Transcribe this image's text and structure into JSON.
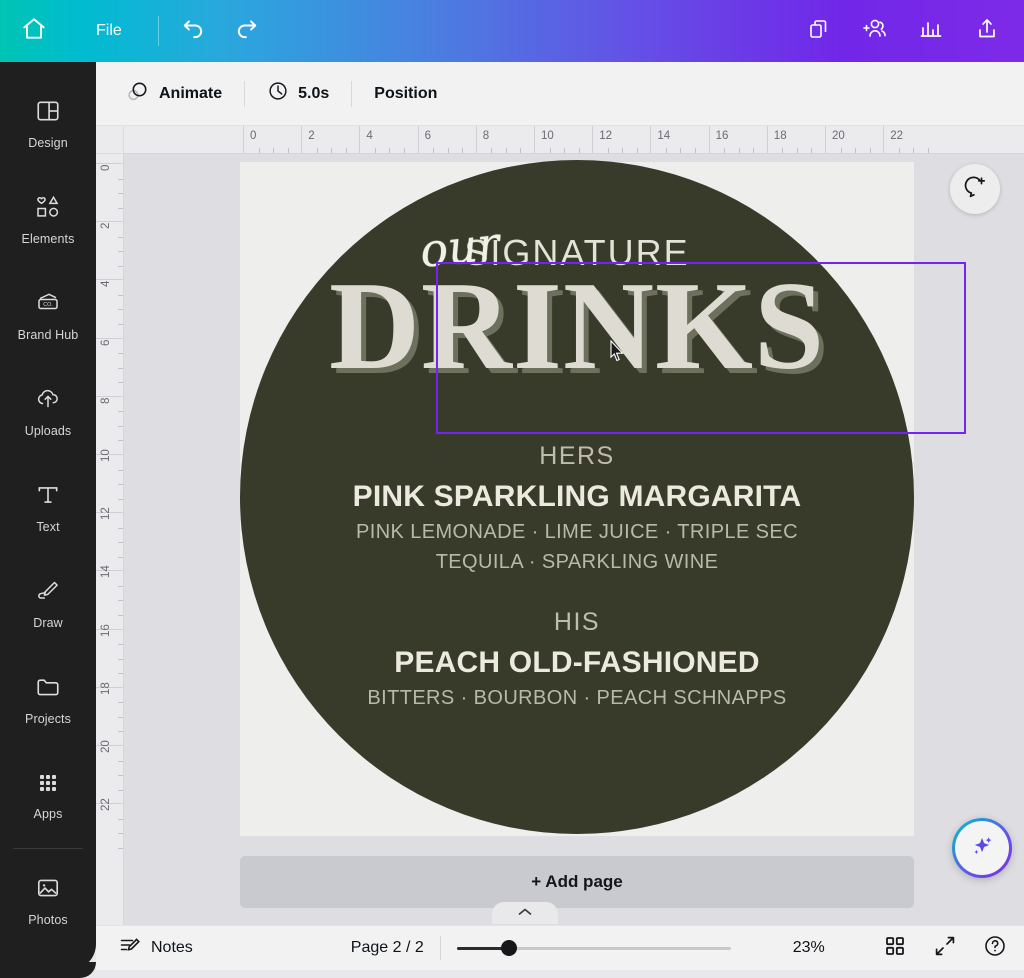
{
  "topbar": {
    "home_icon": "home-icon",
    "file_label": "File",
    "undo_icon": "undo-icon",
    "redo_icon": "redo-icon",
    "right_icons": [
      {
        "name": "duplicate-pages-icon",
        "label": "Duplicate pages"
      },
      {
        "name": "add-collaborator-icon",
        "label": "Add collaborator"
      },
      {
        "name": "insights-icon",
        "label": "Insights"
      },
      {
        "name": "share-icon",
        "label": "Share"
      }
    ],
    "gradient_start": "#00c4cc",
    "gradient_end": "#7d2ae8"
  },
  "sidebar": {
    "items": [
      {
        "label": "Design",
        "icon": "design-layout-icon"
      },
      {
        "label": "Elements",
        "icon": "elements-shapes-icon"
      },
      {
        "label": "Brand Hub",
        "icon": "brand-hub-icon"
      },
      {
        "label": "Uploads",
        "icon": "upload-cloud-icon"
      },
      {
        "label": "Text",
        "icon": "text-type-icon"
      },
      {
        "label": "Draw",
        "icon": "draw-pen-icon"
      },
      {
        "label": "Projects",
        "icon": "folder-icon"
      },
      {
        "label": "Apps",
        "icon": "apps-grid-icon"
      },
      {
        "label": "Photos",
        "icon": "photos-image-icon"
      }
    ]
  },
  "toolbar": {
    "animate_label": "Animate",
    "animate_icon": "animate-circles-icon",
    "duration_label": "5.0s",
    "duration_icon": "clock-icon",
    "position_label": "Position"
  },
  "rulers": {
    "horizontal_ticks": [
      "0",
      "2",
      "4",
      "6",
      "8",
      "10",
      "12",
      "14",
      "16",
      "18",
      "20",
      "22"
    ],
    "vertical_ticks": [
      "0",
      "2",
      "4",
      "6",
      "8",
      "10",
      "12",
      "14",
      "16",
      "18",
      "20",
      "22"
    ],
    "unit_step": 2
  },
  "canvas": {
    "background_color": "#dddde2",
    "page_color": "#eeeeec",
    "circle_color": "#383b2a",
    "selection_color": "#7324f5",
    "design": {
      "script_word": "our",
      "signature_word": "SIGNATURE",
      "drinks_word": "DRINKS",
      "hers": {
        "heading": "HERS",
        "title": "PINK SPARKLING MARGARITA",
        "ingredients_line1": "PINK LEMONADE · LIME JUICE · TRIPLE SEC",
        "ingredients_line2": "TEQUILA · SPARKLING WINE"
      },
      "his": {
        "heading": "HIS",
        "title": "PEACH OLD-FASHIONED",
        "ingredients_line1": "BITTERS · BOURBON · PEACH SCHNAPPS"
      }
    },
    "comment_icon": "add-comment-icon",
    "magic_icon": "magic-sparkles-icon",
    "add_page_label": "+ Add page",
    "collapse_icon": "chevron-up-icon"
  },
  "bottombar": {
    "notes_label": "Notes",
    "notes_icon": "notes-icon",
    "page_indicator": "Page 2 / 2",
    "zoom_level": "23%",
    "grid_icon": "grid-view-icon",
    "fullscreen_icon": "fullscreen-icon",
    "help_icon": "help-icon"
  }
}
